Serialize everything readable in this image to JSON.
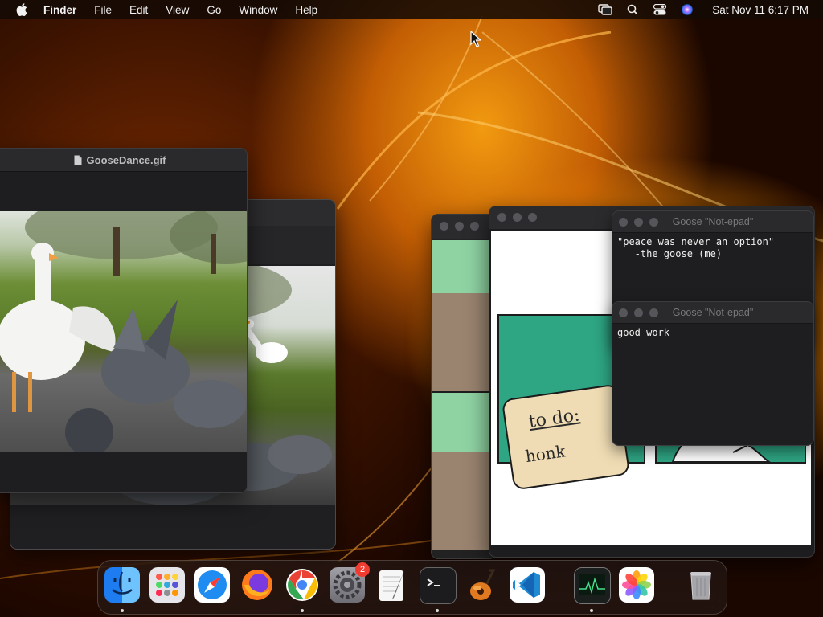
{
  "menubar": {
    "app_name": "Finder",
    "menus": [
      "File",
      "Edit",
      "View",
      "Go",
      "Window",
      "Help"
    ],
    "clock": "Sat Nov 11  6:17 PM",
    "status_icons": [
      "screen-mirroring-icon",
      "spotlight-search-icon",
      "control-center-icon",
      "siri-icon"
    ]
  },
  "windows": {
    "gif_viewer": {
      "title": "GooseDance.gif"
    },
    "comic": {
      "note_line1": "to do:",
      "note_line2": "honk"
    },
    "notepad_top": {
      "title": "Goose \"Not-epad\"",
      "text": "\"peace was never an option\"\n   -the goose (me)"
    },
    "notepad_bottom": {
      "title": "Goose \"Not-epad\"",
      "text": "good work"
    }
  },
  "dock": {
    "apps": [
      {
        "name": "Finder",
        "running": true
      },
      {
        "name": "Launchpad",
        "running": false
      },
      {
        "name": "Safari",
        "running": false
      },
      {
        "name": "Firefox",
        "running": false
      },
      {
        "name": "Google Chrome",
        "running": true
      },
      {
        "name": "System Settings",
        "running": false,
        "badge": "2"
      },
      {
        "name": "TextEdit",
        "running": false
      },
      {
        "name": "Terminal",
        "running": true
      },
      {
        "name": "GarageBand",
        "running": false
      },
      {
        "name": "Visual Studio Code",
        "running": false
      },
      {
        "name": "Activity Monitor",
        "running": true
      },
      {
        "name": "Photos",
        "running": false
      },
      {
        "name": "Trash",
        "running": false
      }
    ]
  },
  "colors": {
    "wallpaper_accent": "#f08a08",
    "menubar_bg": "#140a04",
    "comic_green": "#2ea583",
    "badge_red": "#ef3b30"
  }
}
